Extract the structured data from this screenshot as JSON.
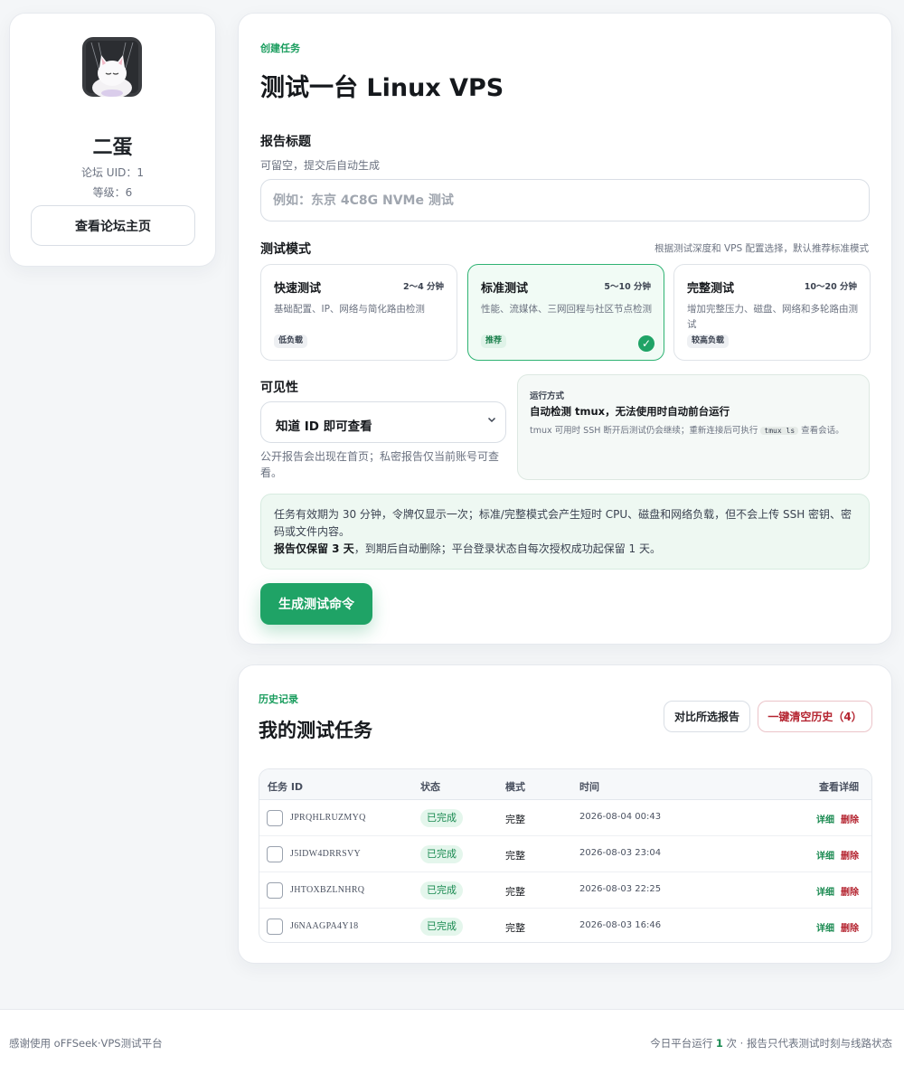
{
  "profile": {
    "name": "二蛋",
    "uid_text": "论坛 UID：1",
    "level_text": "等级：6",
    "forum_button": "查看论坛主页"
  },
  "create": {
    "eyebrow": "创建任务",
    "title": "测试一台 Linux VPS",
    "report_title_label": "报告标题",
    "report_title_hint": "可留空，提交后自动生成",
    "report_title_placeholder": "例如：东京 4C8G NVMe 测试",
    "report_title_value": "",
    "mode_label": "测试模式",
    "mode_hint": "根据测试深度和 VPS 配置选择，默认推荐标准模式",
    "modes": [
      {
        "name": "快速测试",
        "time": "2～4 分钟",
        "desc": "基础配置、IP、网络与简化路由检测",
        "badge": "低负载",
        "selected": false
      },
      {
        "name": "标准测试",
        "time": "5～10 分钟",
        "desc": "性能、流媒体、三网回程与社区节点检测",
        "badge": "推荐",
        "selected": true
      },
      {
        "name": "完整测试",
        "time": "10～20 分钟",
        "desc": "增加完整压力、磁盘、网络和多轮路由测试",
        "badge": "较高负载",
        "selected": false
      }
    ],
    "visibility_label": "可见性",
    "visibility_value": "知道 ID 即可查看",
    "visibility_hint": "公开报告会出现在首页；私密报告仅当前账号可查看。",
    "run_kicker": "运行方式",
    "run_head": "自动检测 tmux，无法使用时自动前台运行",
    "run_desc_before": "tmux 可用时 SSH 断开后测试仍会继续；重新连接后可执行",
    "run_code": "tmux ls",
    "run_desc_after": "查看会话。",
    "notice_line1": "任务有效期为 30 分钟，令牌仅显示一次；标准/完整模式会产生短时 CPU、磁盘和网络负载，但不会上传 SSH 密钥、密码或文件内容。",
    "notice_bold": "报告仅保留 3 天",
    "notice_line2": "，到期后自动删除；平台登录状态自每次授权成功起保留 1 天。",
    "generate_button": "生成测试命令"
  },
  "history": {
    "eyebrow": "历史记录",
    "title": "我的测试任务",
    "compare_button": "对比所选报告",
    "clear_button": "一键清空历史（4）",
    "columns": {
      "id": "任务 ID",
      "status": "状态",
      "mode": "模式",
      "time": "时间",
      "detail": "查看详细"
    },
    "rows": [
      {
        "id": "JPRQHLRUZMYQ",
        "status": "已完成",
        "mode": "完整",
        "time": "2026-08-04 00:43",
        "detail": "详细",
        "delete": "删除"
      },
      {
        "id": "J5IDW4DRRSVY",
        "status": "已完成",
        "mode": "完整",
        "time": "2026-08-03 23:04",
        "detail": "详细",
        "delete": "删除"
      },
      {
        "id": "JHTOXBZLNHRQ",
        "status": "已完成",
        "mode": "完整",
        "time": "2026-08-03 22:25",
        "detail": "详细",
        "delete": "删除"
      },
      {
        "id": "J6NAAGPA4Y18",
        "status": "已完成",
        "mode": "完整",
        "time": "2026-08-03 16:46",
        "detail": "详细",
        "delete": "删除"
      }
    ]
  },
  "footer": {
    "left": "感谢使用 oFFSeek·VPS测试平台",
    "right_before": "今日平台运行",
    "right_count": "1",
    "right_after": "次 · 报告只代表测试时刻与线路状态"
  },
  "colors": {
    "accent": "#1fa366",
    "danger": "#b4232f"
  },
  "icons": {
    "avatar": "cat-avatar",
    "select": "chevron-down-icon",
    "selected_mode": "check-icon"
  }
}
